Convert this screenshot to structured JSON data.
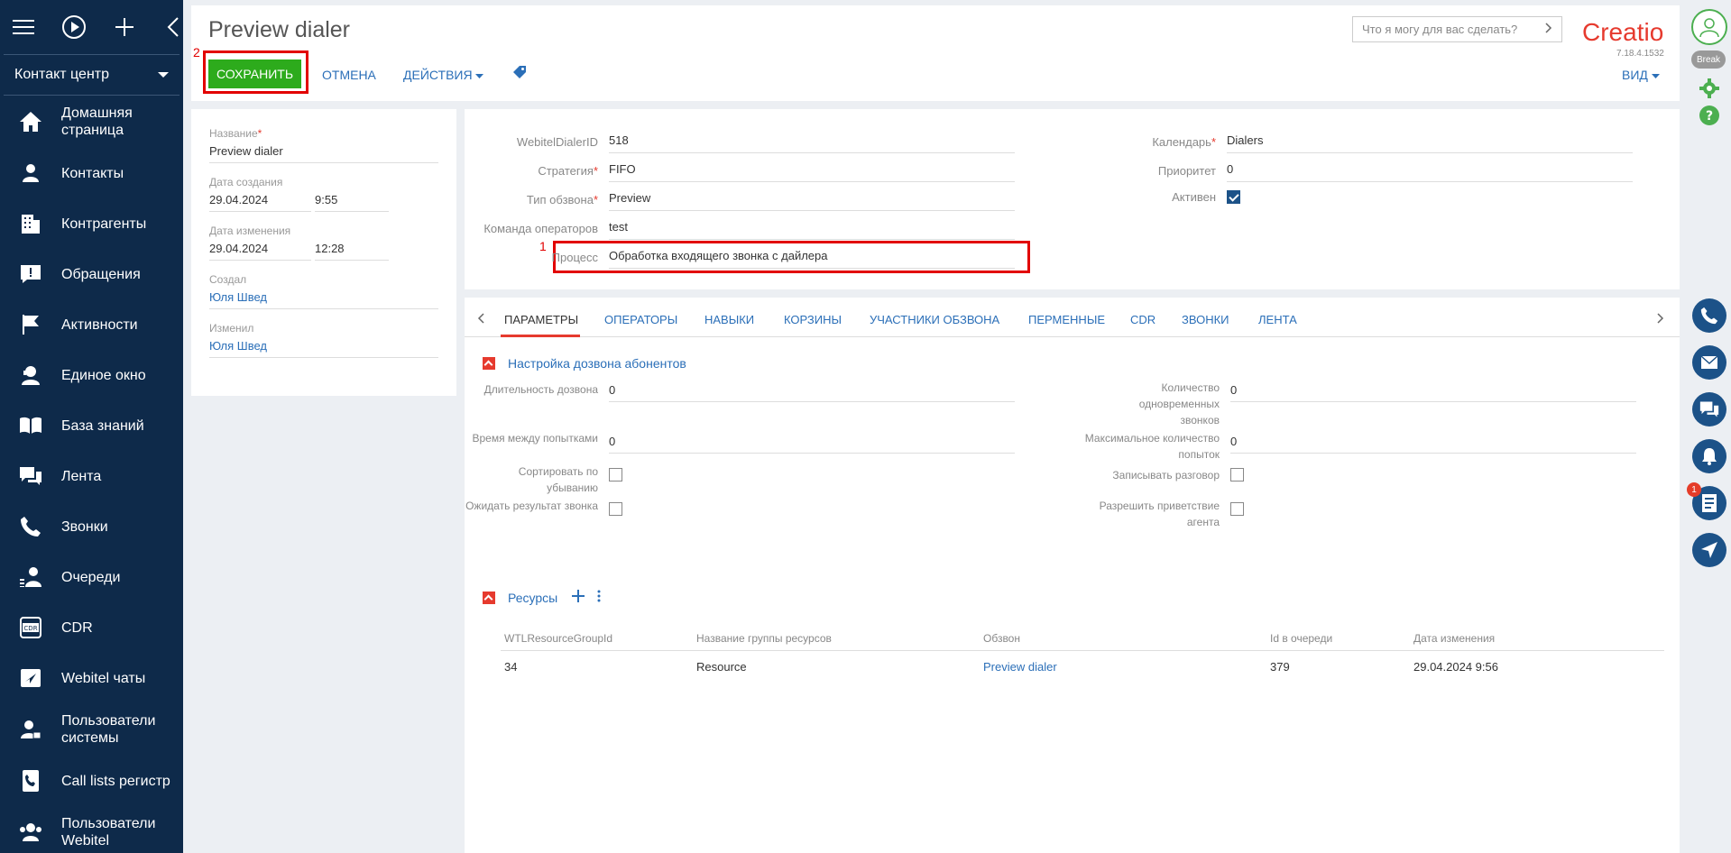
{
  "sidebar": {
    "section_select": "Контакт центр",
    "items": [
      {
        "label": "Домашняя страница",
        "icon": "home-icon"
      },
      {
        "label": "Контакты",
        "icon": "contact-icon"
      },
      {
        "label": "Контрагенты",
        "icon": "building-icon"
      },
      {
        "label": "Обращения",
        "icon": "case-icon"
      },
      {
        "label": "Активности",
        "icon": "flag-icon"
      },
      {
        "label": "Единое окно",
        "icon": "agent-icon"
      },
      {
        "label": "База знаний",
        "icon": "book-icon"
      },
      {
        "label": "Лента",
        "icon": "feed-icon"
      },
      {
        "label": "Звонки",
        "icon": "phone-icon"
      },
      {
        "label": "Очереди",
        "icon": "queue-icon"
      },
      {
        "label": "CDR",
        "icon": "cdr-icon"
      },
      {
        "label": "Webitel чаты",
        "icon": "chat-send-icon"
      },
      {
        "label": "Пользователи системы",
        "icon": "user-lock-icon"
      },
      {
        "label": "Call lists регистр",
        "icon": "call-list-icon"
      },
      {
        "label": "Пользователи Webitel",
        "icon": "users-icon"
      }
    ]
  },
  "header": {
    "title": "Preview dialer",
    "save_label": "СОХРАНИТЬ",
    "cancel_label": "ОТМЕНА",
    "actions_label": "ДЕЙСТВИЯ",
    "view_label": "ВИД",
    "search_placeholder": "Что я могу для вас сделать?",
    "logo_text": "Creatio",
    "version": "7.18.4.1532",
    "annotation_save": "2",
    "annotation_process": "1"
  },
  "rightbar": {
    "status_label": "Break",
    "badge_count": "1"
  },
  "left_panel": {
    "name_label": "Название",
    "name_value": "Preview dialer",
    "created_label": "Дата создания",
    "created_date": "29.04.2024",
    "created_time": "9:55",
    "modified_label": "Дата изменения",
    "modified_date": "29.04.2024",
    "modified_time": "12:28",
    "created_by_label": "Создал",
    "created_by": "Юля Швед",
    "modified_by_label": "Изменил",
    "modified_by": "Юля Швед"
  },
  "record": {
    "dialer_id_label": "WebitelDialerID",
    "dialer_id": "518",
    "strategy_label": "Стратегия",
    "strategy": "FIFO",
    "call_type_label": "Тип обзвона",
    "call_type": "Preview",
    "team_label": "Команда операторов",
    "team": "test",
    "process_label": "Процесс",
    "process": "Обработка входящего звонка с дайлера",
    "calendar_label": "Календарь",
    "calendar": "Dialers",
    "priority_label": "Приоритет",
    "priority": "0",
    "active_label": "Активен",
    "active": true
  },
  "tabs": [
    "ПАРАМЕТРЫ",
    "ОПЕРАТОРЫ",
    "НАВЫКИ",
    "КОРЗИНЫ",
    "УЧАСТНИКИ ОБЗВОНА",
    "ПЕРМЕННЫЕ",
    "CDR",
    "ЗВОНКИ",
    "ЛЕНТА"
  ],
  "params": {
    "group_title": "Настройка дозвона абонентов",
    "dial_duration_label": "Длительность дозвона",
    "dial_duration": "0",
    "retry_interval_label": "Время между попытками",
    "retry_interval": "0",
    "sort_desc_label": "Сортировать по убыванию",
    "wait_result_label": "Ожидать результат звонка",
    "concurrent_label": "Количество одновременных звонков",
    "concurrent": "0",
    "max_attempts_label": "Максимальное количество попыток",
    "max_attempts": "0",
    "record_call_label": "Записывать разговор",
    "allow_greeting_label": "Разрешить приветствие агента"
  },
  "resources": {
    "group_title": "Ресурсы",
    "columns": [
      "WTLResourceGroupId",
      "Название группы ресурсов",
      "Обзвон",
      "Id в очереди",
      "Дата изменения"
    ],
    "rows": [
      [
        "34",
        "Resource",
        "Preview dialer",
        "379",
        "29.04.2024 9:56"
      ]
    ]
  },
  "colors": {
    "sidebar": "#0e2a4a",
    "accent": "#e63a2e",
    "save": "#2dab1c",
    "link": "#2b6fb8",
    "highlight": "#e20000"
  }
}
